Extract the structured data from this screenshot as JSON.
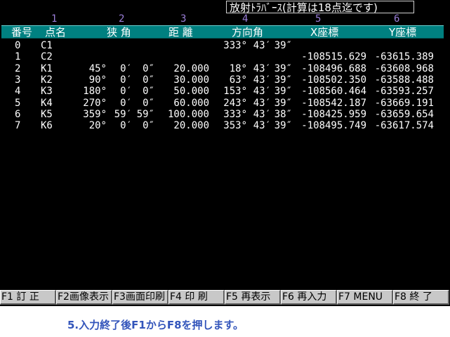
{
  "title": "放射ﾄﾗﾊﾞｰｽ(計算は18点迄です)",
  "column_numbers": [
    "1",
    "2",
    "3",
    "4",
    "5",
    "6"
  ],
  "headers": {
    "no": "番号",
    "name": "点名",
    "angle": "狭 角",
    "distance": "距 離",
    "bearing": "方向角",
    "x": "X座標",
    "y": "Y座標"
  },
  "rows": [
    {
      "no": "0",
      "name": "C1",
      "deg": "",
      "min": "",
      "sec": "",
      "dist": "",
      "b_deg": "333°",
      "b_min": "43′",
      "b_sec": "39″",
      "x": "",
      "y": ""
    },
    {
      "no": "1",
      "name": "C2",
      "deg": "",
      "min": "",
      "sec": "",
      "dist": "",
      "b_deg": "",
      "b_min": "",
      "b_sec": "",
      "x": "-108515.629",
      "y": "-63615.389"
    },
    {
      "no": "2",
      "name": "K1",
      "deg": "45°",
      "min": "0′",
      "sec": "0″",
      "dist": "20.000",
      "b_deg": "18°",
      "b_min": "43′",
      "b_sec": "39″",
      "x": "-108496.688",
      "y": "-63608.968"
    },
    {
      "no": "3",
      "name": "K2",
      "deg": "90°",
      "min": "0′",
      "sec": "0″",
      "dist": "30.000",
      "b_deg": "63°",
      "b_min": "43′",
      "b_sec": "39″",
      "x": "-108502.350",
      "y": "-63588.488"
    },
    {
      "no": "4",
      "name": "K3",
      "deg": "180°",
      "min": "0′",
      "sec": "0″",
      "dist": "50.000",
      "b_deg": "153°",
      "b_min": "43′",
      "b_sec": "39″",
      "x": "-108560.464",
      "y": "-63593.257"
    },
    {
      "no": "5",
      "name": "K4",
      "deg": "270°",
      "min": "0′",
      "sec": "0″",
      "dist": "60.000",
      "b_deg": "243°",
      "b_min": "43′",
      "b_sec": "39″",
      "x": "-108542.187",
      "y": "-63669.191"
    },
    {
      "no": "6",
      "name": "K5",
      "deg": "359°",
      "min": "59′",
      "sec": "59″",
      "dist": "100.000",
      "b_deg": "333°",
      "b_min": "43′",
      "b_sec": "38″",
      "x": "-108425.959",
      "y": "-63659.654"
    },
    {
      "no": "7",
      "name": "K6",
      "deg": "20°",
      "min": "0′",
      "sec": "0″",
      "dist": "20.000",
      "b_deg": "353°",
      "b_min": "43′",
      "b_sec": "39″",
      "x": "-108495.749",
      "y": "-63617.574"
    }
  ],
  "function_keys": [
    {
      "label": "F1 訂 正"
    },
    {
      "label": "F2画像表示"
    },
    {
      "label": "F3画面印刷"
    },
    {
      "label": "F4 印 刷"
    },
    {
      "label": "F5 再表示"
    },
    {
      "label": "F6 再入力"
    },
    {
      "label": "F7 MENU"
    },
    {
      "label": "F8 終 了"
    }
  ],
  "caption": "5.入力終了後F1からF8を押します。",
  "colors": {
    "screen_bg": "#000000",
    "header_bar": "#008080",
    "column_numbers": "#9b7fd9",
    "caption": "#3355bb",
    "function_key_bg": "#c8c8c8"
  }
}
